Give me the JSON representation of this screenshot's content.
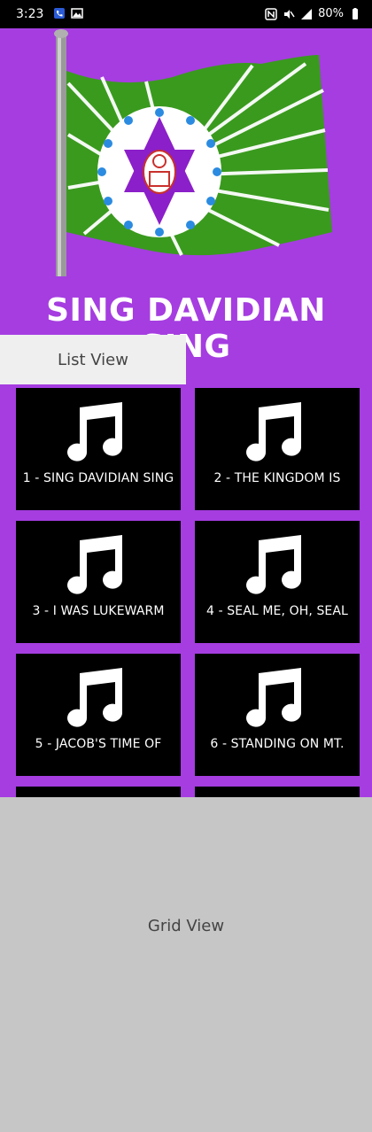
{
  "status_bar": {
    "time": "3:23",
    "battery": "80%",
    "left_icons": [
      "phone-icon",
      "image-icon"
    ],
    "right_icons": [
      "nfc-icon",
      "mute-icon",
      "signal-icon",
      "battery-icon"
    ]
  },
  "header": {
    "title": "SING DAVIDIAN SING"
  },
  "tabs": [
    {
      "label": "List View",
      "active": true
    },
    {
      "label": "Grid View",
      "active": false
    }
  ],
  "songs": [
    {
      "label": "1 - SING DAVIDIAN SING"
    },
    {
      "label": "2 - THE KINGDOM IS"
    },
    {
      "label": "3 - I WAS LUKEWARM"
    },
    {
      "label": "4 - SEAL ME, OH, SEAL"
    },
    {
      "label": "5 - JACOB'S TIME OF"
    },
    {
      "label": "6 - STANDING ON MT."
    }
  ],
  "colors": {
    "background": "#a53de0",
    "card": "#000000",
    "flag_green": "#3a9a1e",
    "flag_purple": "#8b1fc9"
  }
}
